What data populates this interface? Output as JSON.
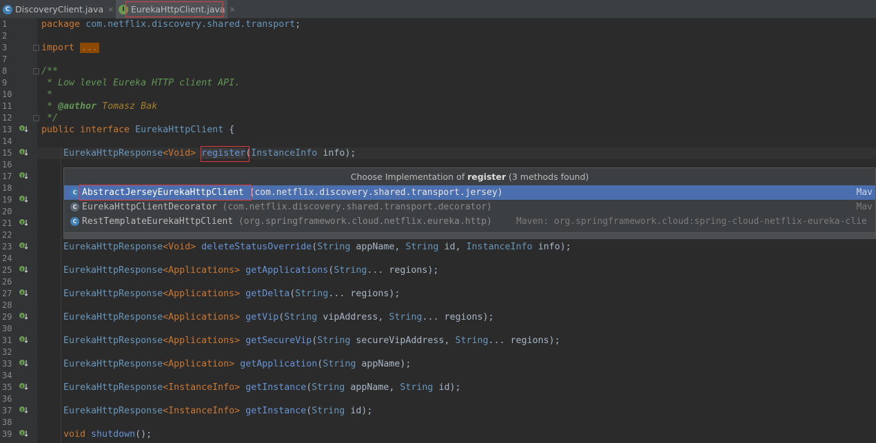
{
  "tabs": [
    {
      "name": "DiscoveryClient.java",
      "icon": "class-icon",
      "active": false,
      "close": "×"
    },
    {
      "name": "EurekaHttpClient.java",
      "icon": "interface-icon",
      "active": true,
      "close": "×"
    }
  ],
  "line_numbers": [
    "1",
    "2",
    "3",
    "7",
    "8",
    "9",
    "10",
    "11",
    "12",
    "13",
    "14",
    "15",
    "16",
    "17",
    "18",
    "19",
    "20",
    "21",
    "22",
    "23",
    "24",
    "25",
    "26",
    "27",
    "28",
    "29",
    "30",
    "31",
    "32",
    "33",
    "34",
    "35",
    "36",
    "37",
    "38",
    "39"
  ],
  "code": {
    "package_kw": "package",
    "package_name": "com.netflix.discovery.shared.transport",
    "package_semicolon": ";",
    "import_kw": "import",
    "import_dots": "...",
    "doc_open": "/**",
    "doc_line1": " * Low level Eureka HTTP client API.",
    "doc_line2": " *",
    "doc_author_prefix": " * ",
    "doc_author_tag": "@author",
    "doc_author_name": " Tomasz Bak",
    "doc_close": " */",
    "iface_public": "public",
    "iface_interface": "interface",
    "iface_name": "EurekaHttpClient",
    "iface_brace": " {",
    "register_ret": "EurekaHttpResponse",
    "register_generic": "<Void>",
    "register_name": "register",
    "register_args_open": "(",
    "register_arg_type": "InstanceInfo",
    "register_arg_rest": " info);",
    "methods": [
      {
        "ret": "EurekaHttpResponse",
        "gen": "<Void>",
        "name": "deleteStatusOverride",
        "args": [
          [
            "String",
            " appName, "
          ],
          [
            "String",
            " id, "
          ],
          [
            "InstanceInfo",
            " info);"
          ]
        ]
      },
      {
        "ret": "EurekaHttpResponse",
        "gen": "<Applications>",
        "name": "getApplications",
        "args": [
          [
            "String",
            "... regions);"
          ]
        ]
      },
      {
        "ret": "EurekaHttpResponse",
        "gen": "<Applications>",
        "name": "getDelta",
        "args": [
          [
            "String",
            "... regions);"
          ]
        ]
      },
      {
        "ret": "EurekaHttpResponse",
        "gen": "<Applications>",
        "name": "getVip",
        "args": [
          [
            "String",
            " vipAddress, "
          ],
          [
            "String",
            "... regions);"
          ]
        ]
      },
      {
        "ret": "EurekaHttpResponse",
        "gen": "<Applications>",
        "name": "getSecureVip",
        "args": [
          [
            "String",
            " secureVipAddress, "
          ],
          [
            "String",
            "... regions);"
          ]
        ]
      },
      {
        "ret": "EurekaHttpResponse",
        "gen": "<Application>",
        "name": "getApplication",
        "args": [
          [
            "String",
            " appName);"
          ]
        ]
      },
      {
        "ret": "EurekaHttpResponse",
        "gen": "<InstanceInfo>",
        "name": "getInstance",
        "args": [
          [
            "String",
            " appName, "
          ],
          [
            "String",
            " id);"
          ]
        ]
      },
      {
        "ret": "EurekaHttpResponse",
        "gen": "<InstanceInfo>",
        "name": "getInstance",
        "args": [
          [
            "String",
            " id);"
          ]
        ]
      }
    ],
    "shutdown_kw": "void",
    "shutdown_name": "shutdown",
    "shutdown_rest": "();"
  },
  "popup": {
    "title_prefix": "Choose Implementation of ",
    "title_method": "register",
    "title_suffix": " (3 methods found)",
    "items": [
      {
        "name": "AbstractJerseyEurekaHttpClient",
        "pkg": " (com.netflix.discovery.shared.transport.jersey)",
        "right": "Mav",
        "selected": true
      },
      {
        "name": "EurekaHttpClientDecorator",
        "pkg": " (com.netflix.discovery.shared.transport.decorator)",
        "right": "Mav",
        "selected": false
      },
      {
        "name": "RestTemplateEurekaHttpClient",
        "pkg": " (org.springframework.cloud.netflix.eureka.http)",
        "right": "Maven: org.springframework.cloud:spring-cloud-netflix-eureka-clie",
        "selected": false
      }
    ]
  },
  "icons": {
    "class_glyph": "C",
    "interface_glyph": "I",
    "impl_marker": "implemented-icon"
  },
  "colors": {
    "editor_bg": "#2b2b2b",
    "keyword": "#cc7832",
    "comment": "#629755",
    "selection": "#4b6eaf",
    "highlight_box": "#e0393e"
  }
}
